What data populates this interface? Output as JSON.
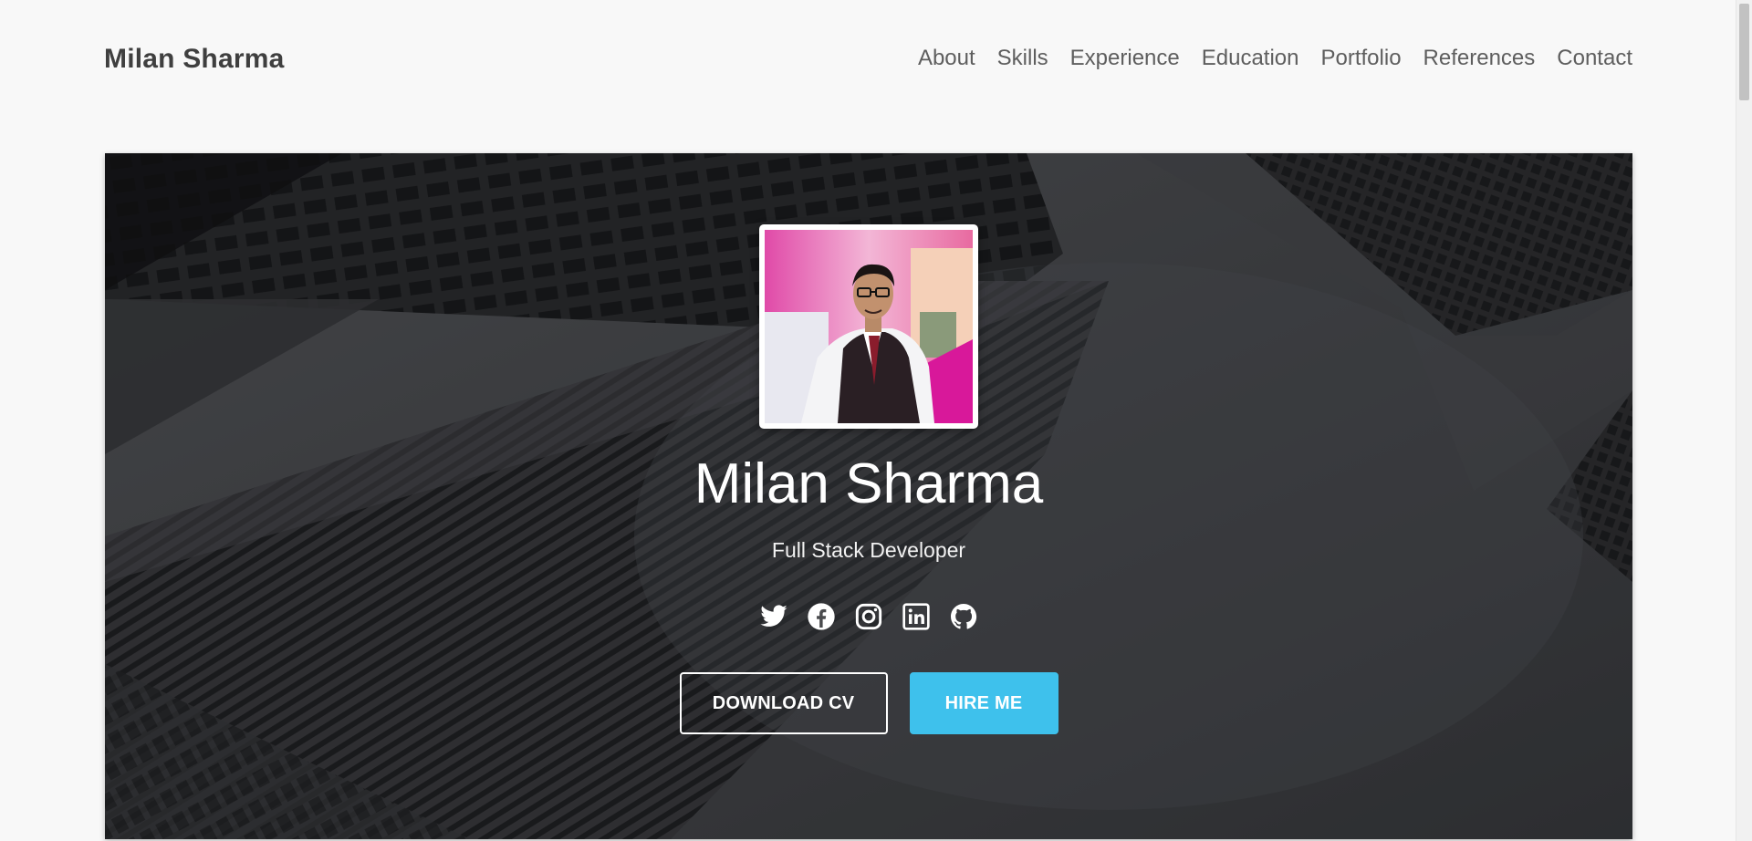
{
  "header": {
    "brand": "Milan Sharma",
    "nav": [
      "About",
      "Skills",
      "Experience",
      "Education",
      "Portfolio",
      "References",
      "Contact"
    ]
  },
  "hero": {
    "name": "Milan Sharma",
    "role": "Full Stack Developer",
    "socials": [
      "twitter-icon",
      "facebook-icon",
      "instagram-icon",
      "linkedin-icon",
      "github-icon"
    ],
    "buttons": {
      "download": "DOWNLOAD CV",
      "hire": "HIRE ME"
    }
  },
  "colors": {
    "accent": "#3ec1ec",
    "brand_text": "#3f3f3f",
    "nav_text": "#5e5e5e",
    "page_bg": "#f8f8f8"
  }
}
